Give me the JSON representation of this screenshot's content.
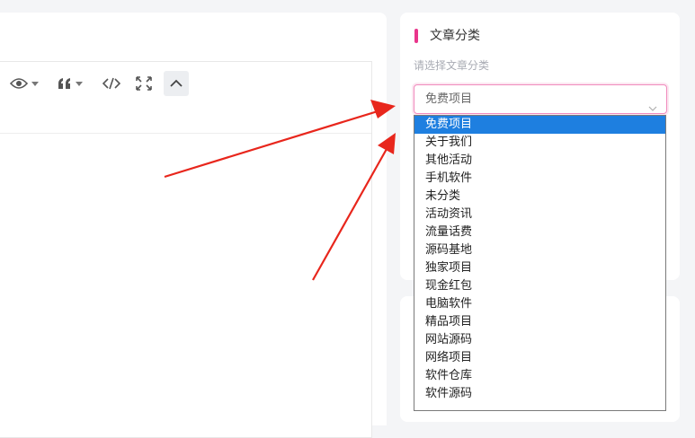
{
  "category": {
    "title": "文章分类",
    "hint": "请选择文章分类",
    "selected": "免费项目",
    "options": [
      "免费项目",
      "关于我们",
      "其他活动",
      "手机软件",
      "未分类",
      "活动资讯",
      "流量话费",
      "源码基地",
      "独家项目",
      "现金红包",
      "电脑软件",
      "精品项目",
      "网站源码",
      "网络项目",
      "软件仓库",
      "软件源码"
    ]
  },
  "toolbar": {
    "icons": [
      "preview-icon",
      "quote-icon",
      "code-icon",
      "fullscreen-icon",
      "collapse-icon"
    ]
  },
  "colors": {
    "accent_bar": "#e9358b",
    "select_border": "#f08bbd",
    "option_highlight": "#1e7fe0",
    "arrow": "#e8261c"
  }
}
